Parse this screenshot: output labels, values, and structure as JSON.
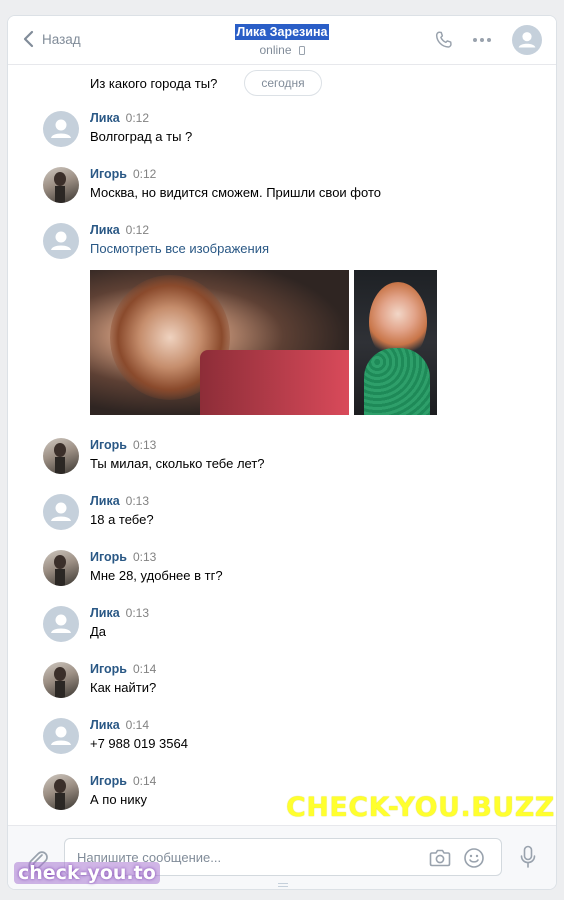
{
  "header": {
    "back_label": "Назад",
    "title": "Лика Зарезина",
    "status": "online"
  },
  "conversation": {
    "top_text": "Из какого города ты?",
    "date_pill": "сегодня",
    "messages": [
      {
        "sender": "Лика",
        "time": "0:12",
        "text": "Волгоград а ты ?",
        "avatar": "placeholder"
      },
      {
        "sender": "Игорь",
        "time": "0:12",
        "text": "Москва, но видится сможем. Пришли свои фото",
        "avatar": "photo"
      },
      {
        "sender": "Лика",
        "time": "0:12",
        "link": "Посмотреть все изображения",
        "avatar": "placeholder"
      },
      {
        "sender": "Игорь",
        "time": "0:13",
        "text": "Ты милая, сколько тебе лет?",
        "avatar": "photo"
      },
      {
        "sender": "Лика",
        "time": "0:13",
        "text": "18 а тебе?",
        "avatar": "placeholder"
      },
      {
        "sender": "Игорь",
        "time": "0:13",
        "text": "Мне 28, удобнее в тг?",
        "avatar": "photo"
      },
      {
        "sender": "Лика",
        "time": "0:13",
        "text": "Да",
        "avatar": "placeholder"
      },
      {
        "sender": "Игорь",
        "time": "0:14",
        "text": "Как найти?",
        "avatar": "photo"
      },
      {
        "sender": "Лика",
        "time": "0:14",
        "text": "+7 988 019 3564",
        "avatar": "placeholder"
      },
      {
        "sender": "Игорь",
        "time": "0:14",
        "text": "А по нику",
        "avatar": "photo"
      }
    ]
  },
  "composer": {
    "placeholder": "Напишите сообщение..."
  },
  "watermarks": {
    "big": "CHECK-YOU.BUZZ",
    "small": "check-you.to"
  },
  "colors": {
    "link": "#2a5885",
    "title_highlight": "#2a5ec7",
    "watermark_yellow": "#ffff2e"
  }
}
